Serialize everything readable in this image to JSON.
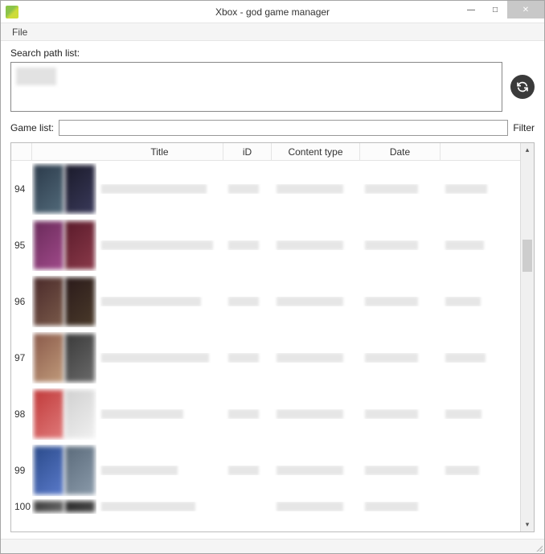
{
  "window": {
    "title": "Xbox - god game manager",
    "minimize": "—",
    "maximize": "□",
    "close": "✕"
  },
  "menubar": {
    "file": "File"
  },
  "search": {
    "label": "Search path list:"
  },
  "gamelist": {
    "label": "Game list:",
    "filter": "Filter",
    "value": ""
  },
  "columns": {
    "title": "Title",
    "id": "iD",
    "ctype": "Content type",
    "date": "Date"
  },
  "rows": [
    {
      "num": "94"
    },
    {
      "num": "95"
    },
    {
      "num": "96"
    },
    {
      "num": "97"
    },
    {
      "num": "98"
    },
    {
      "num": "99"
    },
    {
      "num": "100"
    }
  ]
}
